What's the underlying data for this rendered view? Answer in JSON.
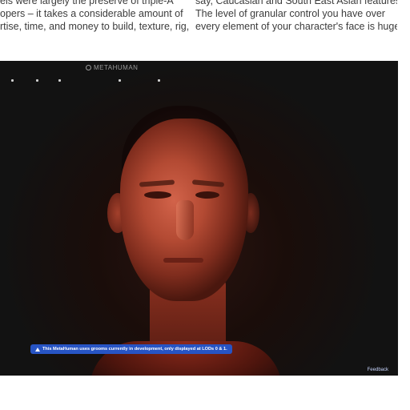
{
  "article": {
    "left_lines": [
      "els were largely the preserve of triple-A",
      "opers – it takes a considerable amount of",
      "rtise, time, and money to build, texture, rig,"
    ],
    "right_lines": [
      "say, Caucasian and South East Asian features.",
      "The level of granular control you have over",
      "every element of your character's face is huge:"
    ]
  },
  "app": {
    "logo_text": "METAHUMAN",
    "warning_text": "This MetaHuman uses grooms currently in development, only displayed at LODs 0 & 1.",
    "feedback_label": "Feedback"
  },
  "colors": {
    "viewport_bg": "#141414",
    "banner_bg": "#2754c4"
  }
}
